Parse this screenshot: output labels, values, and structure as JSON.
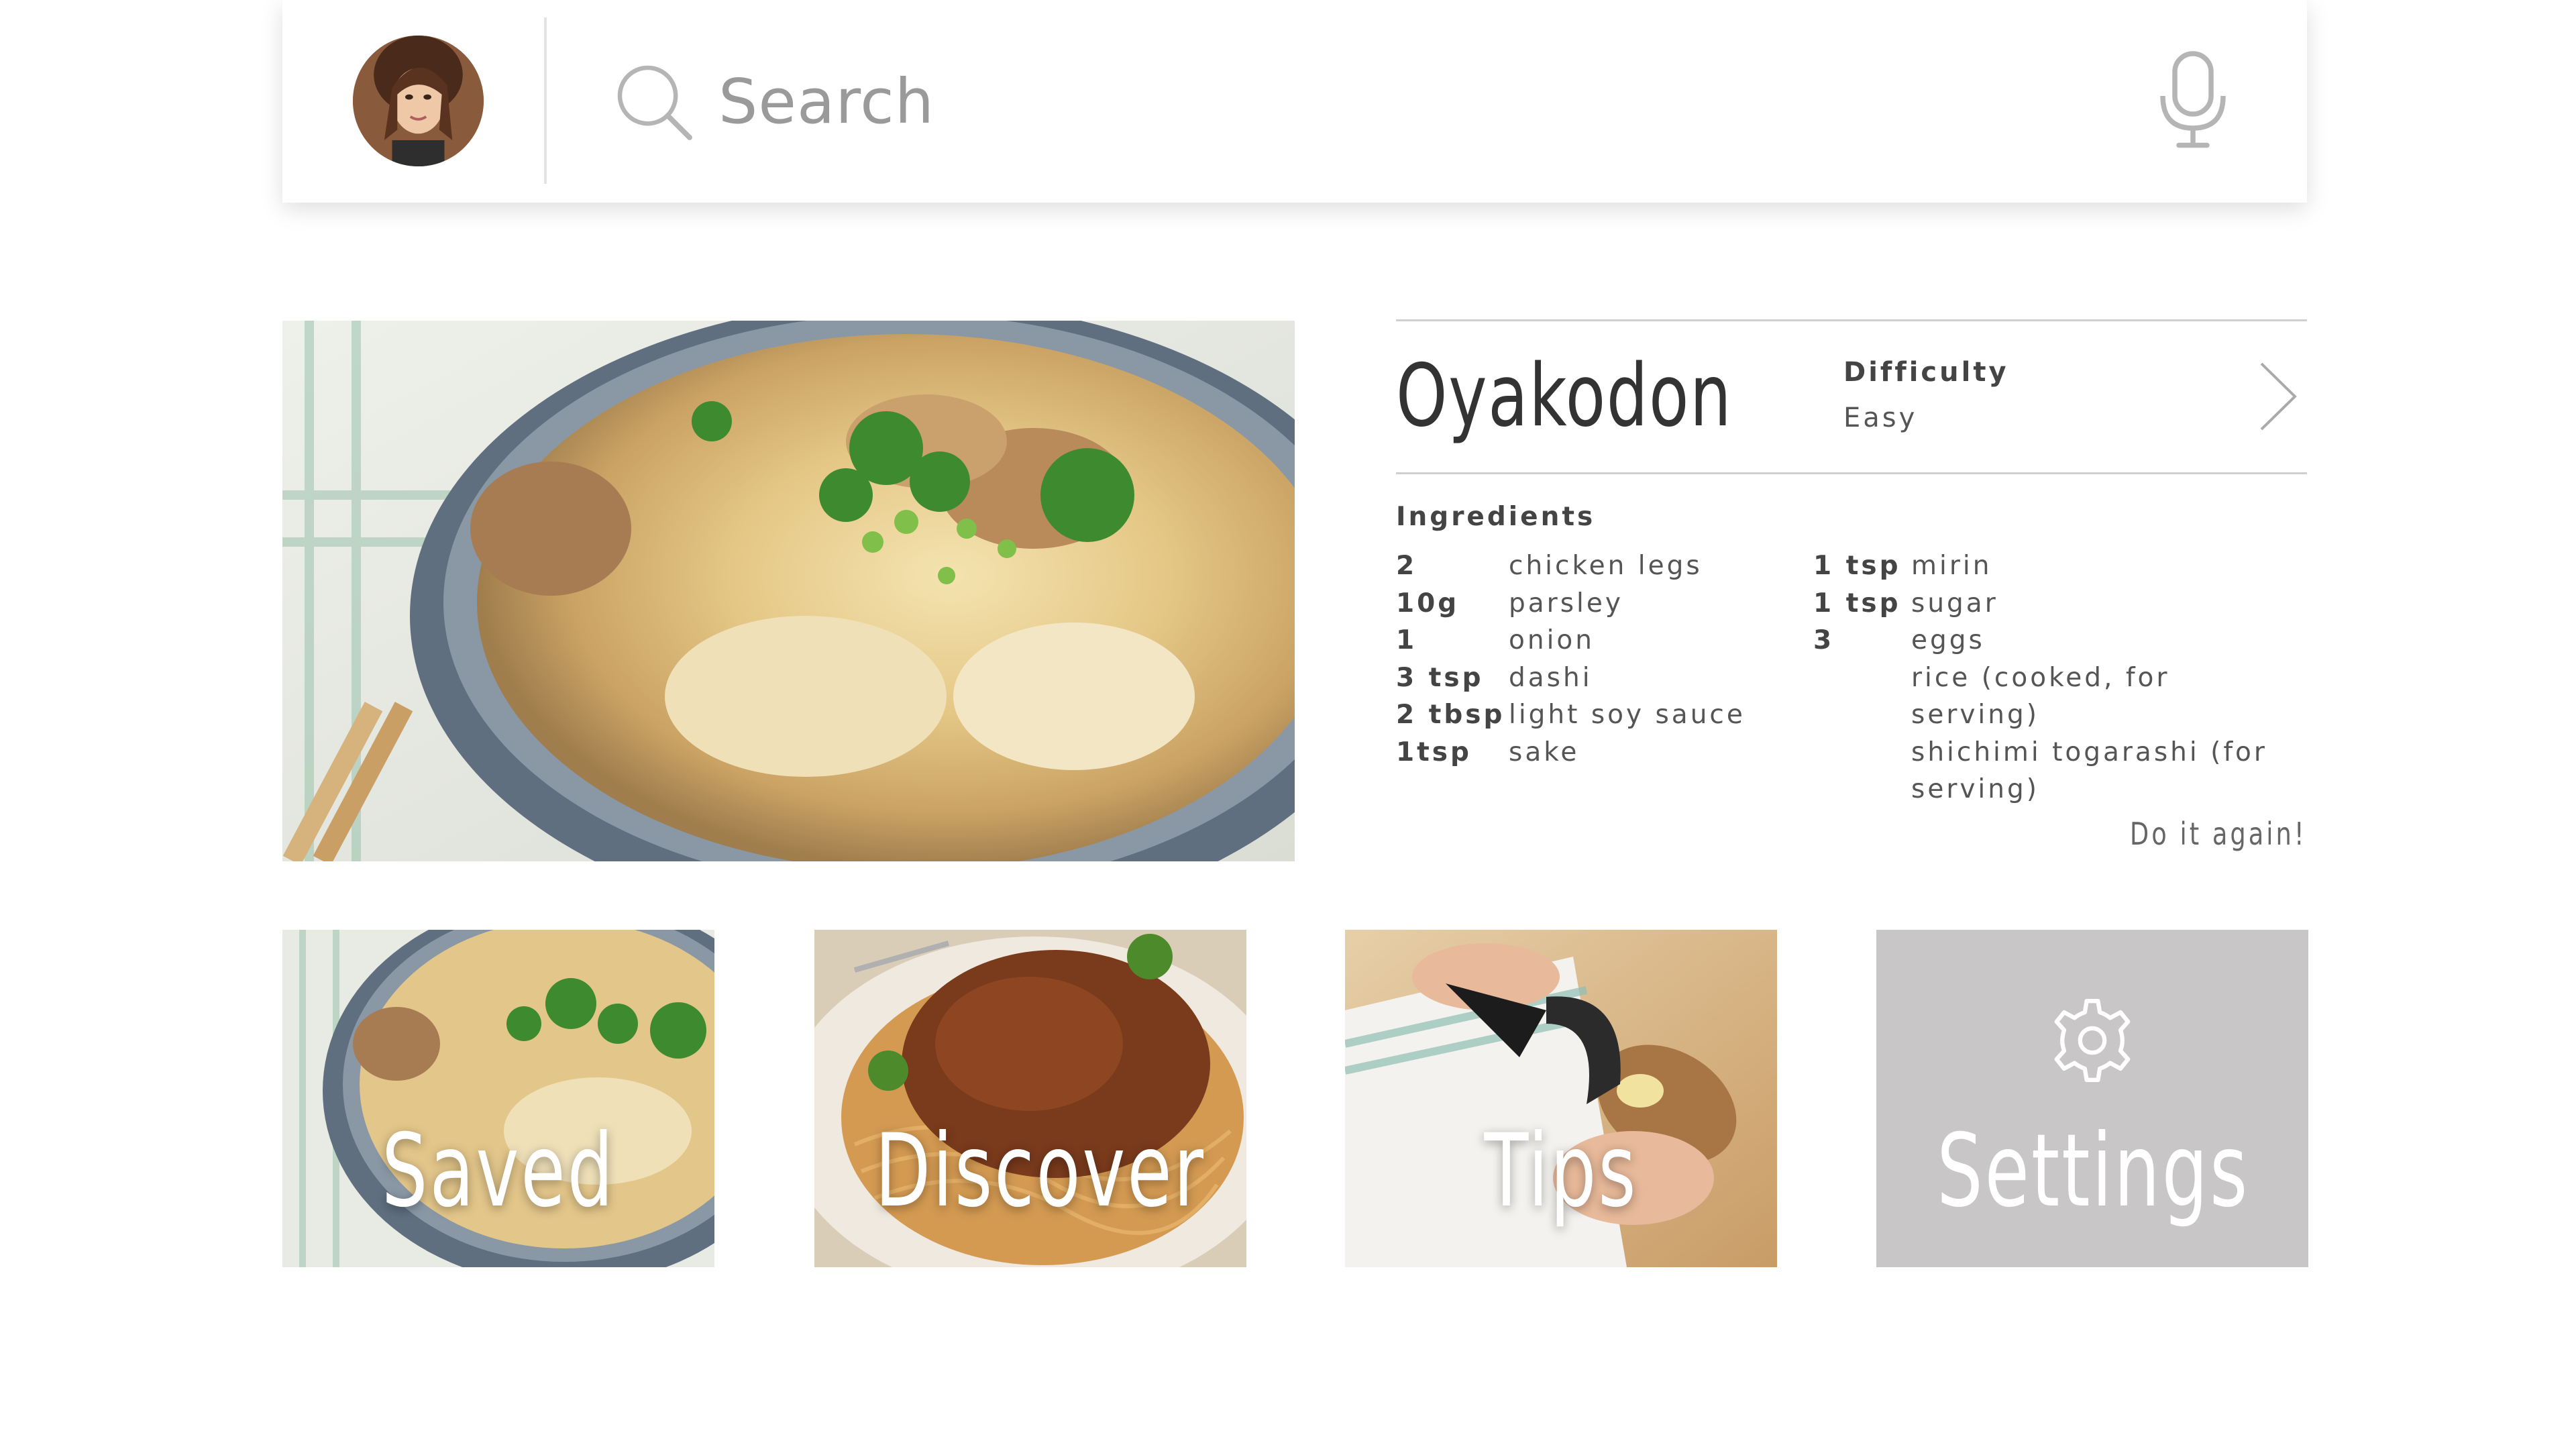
{
  "search": {
    "placeholder": "Search"
  },
  "recipe": {
    "title": "Oyakodon",
    "difficulty_label": "Difficulty",
    "difficulty_value": "Easy",
    "ingredients_heading": "Ingredients",
    "ingredients_left": [
      {
        "qty": "2",
        "name": "chicken legs"
      },
      {
        "qty": "10g",
        "name": "parsley"
      },
      {
        "qty": "1",
        "name": "onion"
      },
      {
        "qty": "3 tsp",
        "name": "dashi"
      },
      {
        "qty": "2 tbsp",
        "name": "light soy sauce"
      },
      {
        "qty": "1tsp",
        "name": "sake"
      }
    ],
    "ingredients_right": [
      {
        "qty": "1 tsp",
        "name": "mirin"
      },
      {
        "qty": "1 tsp",
        "name": "sugar"
      },
      {
        "qty": "3",
        "name": "eggs"
      },
      {
        "qty": "",
        "name": "rice (cooked, for serving)"
      },
      {
        "qty": "",
        "name": "shichimi togarashi (for"
      },
      {
        "qty": "",
        "name": "serving)"
      }
    ],
    "do_again_label": "Do it again!"
  },
  "tiles": [
    {
      "label": "Saved",
      "icon": "bookmark-photo"
    },
    {
      "label": "Discover",
      "icon": "spaghetti-photo"
    },
    {
      "label": "Tips",
      "icon": "peeler-photo"
    },
    {
      "label": "Settings",
      "icon": "gear-icon"
    }
  ],
  "colors": {
    "settings_tile_bg": "#c8c6c6",
    "icon_gray": "#b5b5b5",
    "text_dark": "#333333"
  }
}
